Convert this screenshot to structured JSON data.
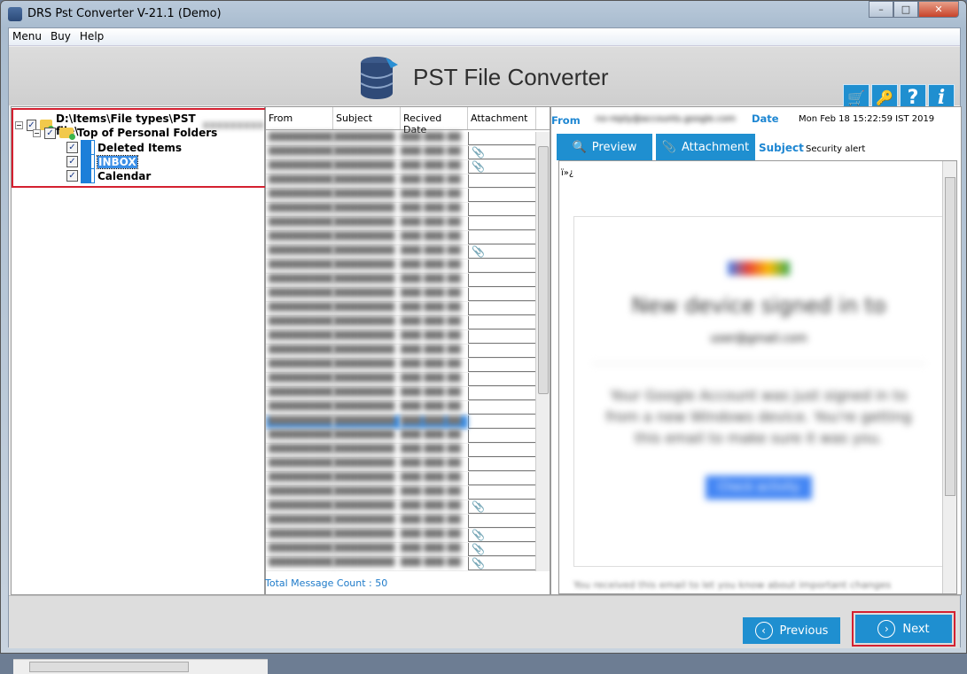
{
  "window": {
    "title": "DRS Pst Converter V-21.1 (Demo)",
    "minimize": "–",
    "maximize": "□",
    "close": "✕"
  },
  "menu": [
    "Menu",
    "Buy",
    "Help"
  ],
  "header": {
    "title": "PST File Converter",
    "tools": [
      {
        "icon": "cart-icon",
        "glyph": "🛒"
      },
      {
        "icon": "key-icon",
        "glyph": "🔑"
      },
      {
        "icon": "help-icon",
        "glyph": "?"
      },
      {
        "icon": "info-icon",
        "glyph": "i"
      }
    ]
  },
  "tree": {
    "root": "D:\\Items\\File types\\PST file\\",
    "root_hidden": "xxxxxxxxx",
    "top": "Top of Personal Folders",
    "folders": [
      "Deleted Items",
      "INBOX",
      "Calendar"
    ],
    "selected": "INBOX"
  },
  "list": {
    "columns": [
      "From",
      "Subject",
      "Recived Date",
      "Attachment"
    ],
    "total": "Total Message Count : 50",
    "attachment_rows": [
      1,
      2,
      8,
      26,
      28,
      29,
      30
    ],
    "selected_row": 20,
    "row_count": 31
  },
  "preview": {
    "from_label": "From",
    "from_value": "no-reply@accounts.google.com",
    "date_label": "Date",
    "date_value": "Mon Feb 18 15:22:59 IST 2019",
    "subject_label": "Subject",
    "subject_value": "Security alert",
    "preview_tab": "Preview",
    "attachment_tab": "Attachment",
    "bom": "ï»¿",
    "email": {
      "heading": "New device signed in to",
      "account": "user@gmail.com",
      "text": "Your Google Account was just signed in to from a new Windows device. You're getting this email to make sure it was you.",
      "button": "Check activity",
      "footer": "You received this email to let you know about important changes"
    }
  },
  "nav": {
    "previous": "Previous",
    "next": "Next"
  },
  "colors": {
    "accent": "#1f8fd0",
    "highlight": "#d42030"
  }
}
